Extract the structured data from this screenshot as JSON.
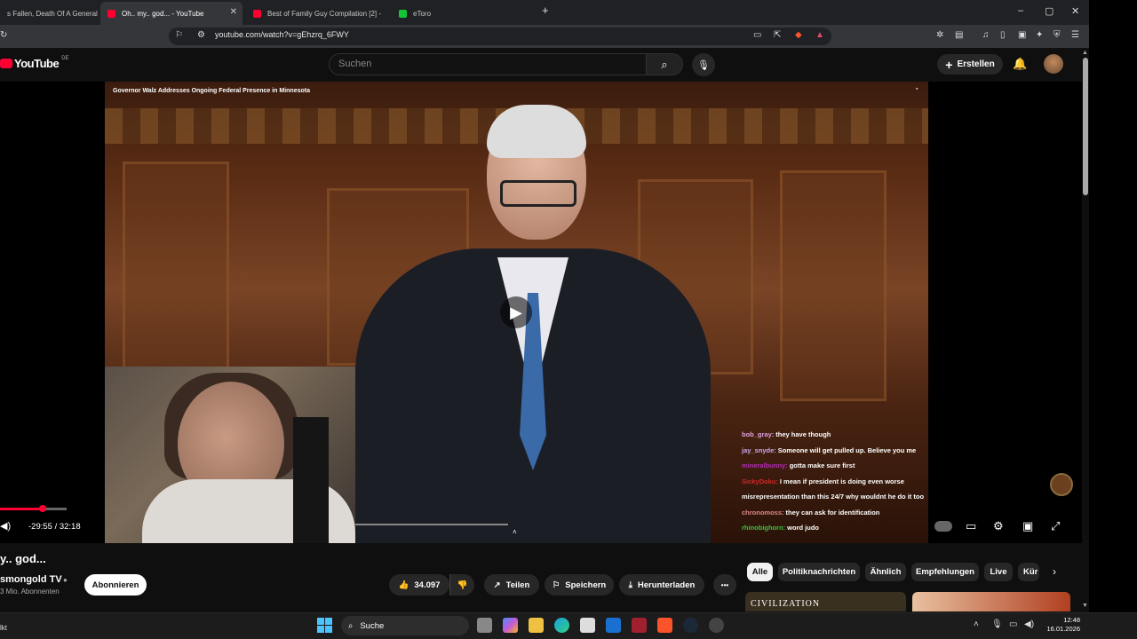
{
  "browser": {
    "tabs": [
      {
        "label": "s Fallen, Death Of A General",
        "fav_color": "#ff0033"
      },
      {
        "label": "Oh.. my.. god... - YouTube",
        "fav_color": "#ff0033",
        "active": true
      },
      {
        "label": "Best of Family Guy Compilation [2] -",
        "fav_color": "#ff0033"
      },
      {
        "label": "eToro",
        "fav_color": "#13c636"
      }
    ],
    "new_tab": "+",
    "url": "youtube.com/watch?v=gEhzrq_6FWY",
    "window": {
      "minimize": "–",
      "maximize": "▢",
      "close": "✕"
    }
  },
  "youtube": {
    "logo_text": "YouTube",
    "logo_region": "DE",
    "search_placeholder": "Suchen",
    "create_label": "Erstellen"
  },
  "video": {
    "overlay_title": "Governor Walz Addresses Ongoing Federal Presence in Minnesota",
    "time": "-29:55 / 32:18",
    "progress_fraction": 0.64,
    "chat": [
      {
        "user": "bob_gray:",
        "color": "#e0a0e0",
        "text": "they have though"
      },
      {
        "user": "jay_snyde:",
        "color": "#c8a8e8",
        "text": "Someone will get pulled up. Believe you me"
      },
      {
        "user": "mineralbunny:",
        "color": "#b030b0",
        "text": "gotta make sure first"
      },
      {
        "user": "SickyDoku:",
        "color": "#d02828",
        "text": "I mean if president is doing even worse misrepresentation than this 24/7 why wouldnt he do it too"
      },
      {
        "user": "chronomoss:",
        "color": "#e08a8a",
        "text": "they can ask for identification"
      },
      {
        "user": "rhinobighorn:",
        "color": "#40c040",
        "text": "word judo"
      }
    ]
  },
  "below": {
    "title": "y.. god...",
    "channel": "smongold TV",
    "subscribers": "3 Mio. Abonnenten",
    "subscribe_label": "Abonnieren",
    "like_count": "34.097",
    "share_label": "Teilen",
    "save_label": "Speichern",
    "download_label": "Herunterladen",
    "more_label": "•••"
  },
  "chips": [
    "Alle",
    "Politiknachrichten",
    "Ähnlich",
    "Empfehlungen",
    "Live",
    "Kür"
  ],
  "thumbnails": [
    {
      "label": "CIVILIZATION",
      "bg": "#3a3020"
    },
    {
      "label": "",
      "bg": "#b04020"
    }
  ],
  "taskbar": {
    "search_label": "Suche",
    "left_text": "lkt",
    "time": "12:48",
    "date": "16.01.2026"
  }
}
